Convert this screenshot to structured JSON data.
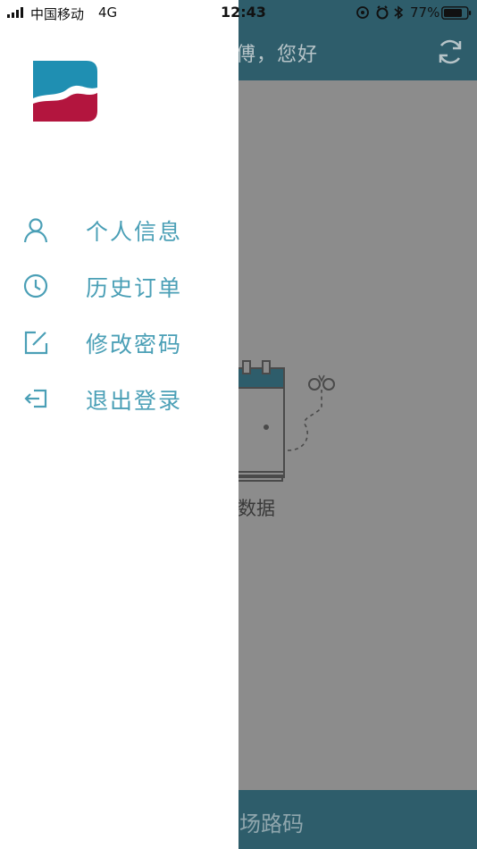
{
  "status_bar": {
    "carrier": "中国移动",
    "network": "4G",
    "time": "12:43",
    "battery": "77%"
  },
  "background": {
    "header_title": "傅，您好",
    "empty_text": "数据",
    "footer_text": "场路码"
  },
  "drawer": {
    "menu": [
      {
        "label": "个人信息",
        "icon": "user-icon"
      },
      {
        "label": "历史订单",
        "icon": "clock-icon"
      },
      {
        "label": "修改密码",
        "icon": "edit-icon"
      },
      {
        "label": "退出登录",
        "icon": "logout-icon"
      }
    ]
  },
  "colors": {
    "accent": "#4a9fb6",
    "header": "#2e5d6b",
    "logo_blue": "#1f8fb2",
    "logo_red": "#b3153e"
  }
}
